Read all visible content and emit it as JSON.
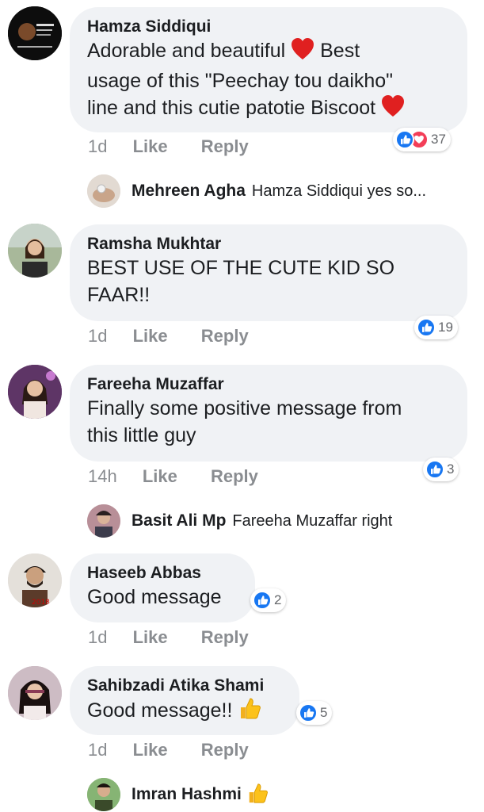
{
  "comments": [
    {
      "name": "Hamza Siddiqui",
      "line1": "Adorable and beautiful",
      "line1b": "Best",
      "line2": "usage of this \"Peechay tou daikho\"",
      "line3": "line and this cutie patotie Biscoot",
      "time": "1d",
      "like": "Like",
      "reply": "Reply",
      "reactions": "37",
      "reply_item": {
        "name": "Mehreen Agha",
        "text": "Hamza Siddiqui  yes so..."
      }
    },
    {
      "name": "Ramsha Mukhtar",
      "line1": "BEST USE OF THE CUTE KID SO",
      "line2": "FAAR!!",
      "time": "1d",
      "like": "Like",
      "reply": "Reply",
      "reactions": "19"
    },
    {
      "name": "Fareeha Muzaffar",
      "line1": "Finally some positive message from",
      "line2": "this little guy",
      "time": "14h",
      "like": "Like",
      "reply": "Reply",
      "reactions": "3",
      "reply_item": {
        "name": "Basit Ali Mp",
        "text": "Fareeha Muzaffar right"
      }
    },
    {
      "name": "Haseeb Abbas",
      "line1": "Good message",
      "time": "1d",
      "like": "Like",
      "reply": "Reply",
      "reactions": "2"
    },
    {
      "name": "Sahibzadi Atika Shami",
      "line1": "Good message!!",
      "time": "1d",
      "like": "Like",
      "reply": "Reply",
      "reactions": "5",
      "reply_item": {
        "name": "Imran Hashmi",
        "text": ""
      }
    }
  ],
  "colors": {
    "like_blue": "#1877f2",
    "love_red": "#f33e58",
    "bubble": "#f0f2f5",
    "meta_gray": "#8a8d91"
  },
  "icons": [
    "like-icon",
    "love-icon",
    "heart-emoji-icon",
    "thumbs-up-emoji-icon"
  ]
}
